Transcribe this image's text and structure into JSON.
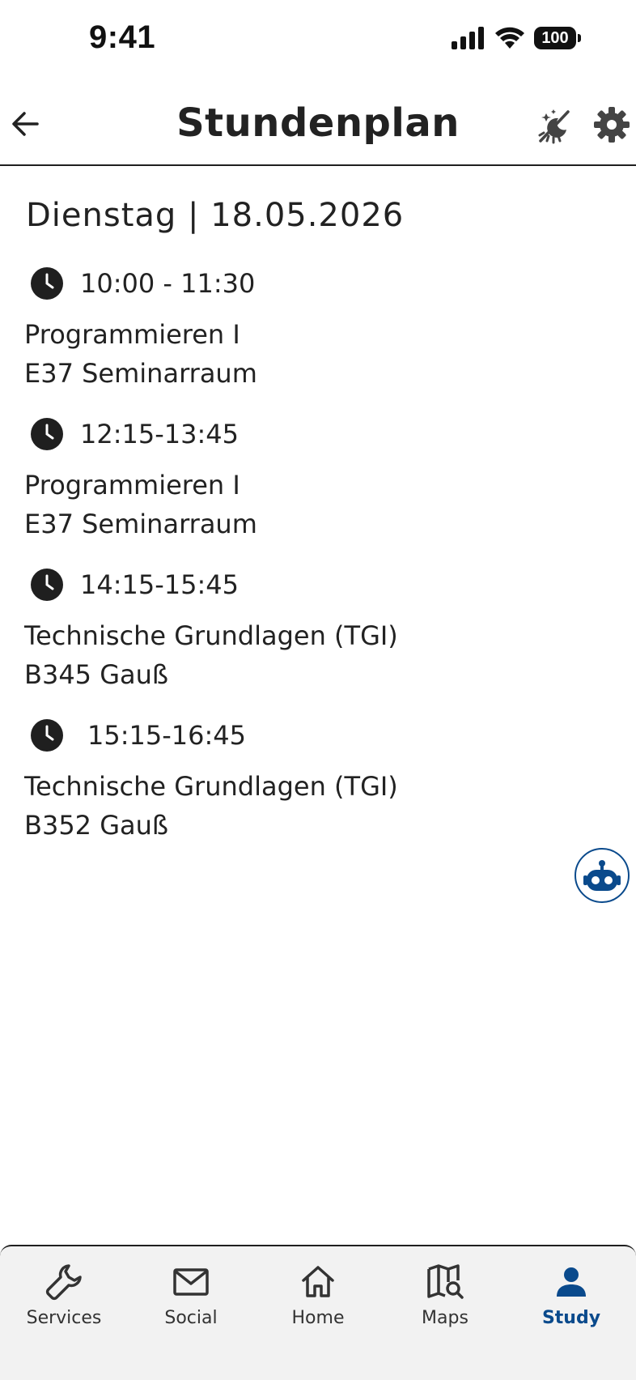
{
  "status_bar": {
    "time": "9:41",
    "battery": "100",
    "icons": [
      "signal-icon",
      "wifi-icon",
      "battery-icon"
    ]
  },
  "header": {
    "title": "Stundenplan",
    "icons": [
      "back-arrow-icon",
      "theme-toggle-icon",
      "gear-icon"
    ]
  },
  "schedule": {
    "date": "Dienstag | 18.05.2026",
    "lessons": [
      {
        "time": "10:00 - 11:30",
        "subject": "Programmieren I",
        "room": "E37 Seminarraum"
      },
      {
        "time": "12:15-13:45",
        "subject": "Programmieren I",
        "room": "E37 Seminarraum"
      },
      {
        "time": "14:15-15:45",
        "subject": "Technische Grundlagen (TGI)",
        "room": "B345 Gauß"
      },
      {
        "time": "15:15-16:45",
        "subject": "Technische Grundlagen (TGI)",
        "room": "B352 Gauß"
      }
    ]
  },
  "chatbot": {
    "icon": "robot-icon"
  },
  "bottom_nav": {
    "items": [
      {
        "label": "Services",
        "icon": "wrench-icon",
        "active": false
      },
      {
        "label": "Social",
        "icon": "mail-icon",
        "active": false
      },
      {
        "label": "Home",
        "icon": "home-icon",
        "active": false
      },
      {
        "label": "Maps",
        "icon": "map-search-icon",
        "active": false
      },
      {
        "label": "Study",
        "icon": "person-icon",
        "active": true
      }
    ]
  },
  "colors": {
    "accent": "#0a4a8c",
    "text": "#222222",
    "nav_background": "#f2f2f2"
  }
}
